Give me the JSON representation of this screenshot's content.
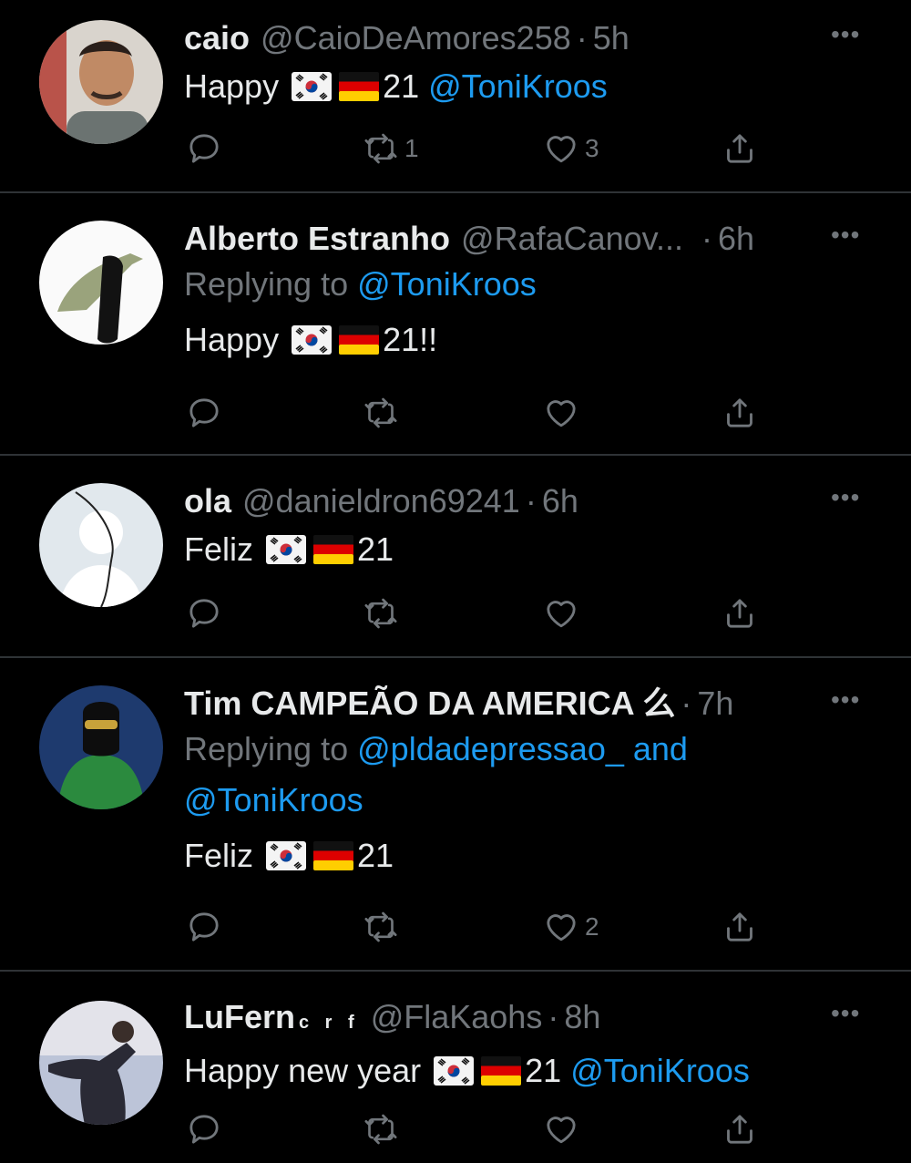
{
  "tweets": [
    {
      "name": "caio",
      "handle": "@CaioDeAmores258",
      "time": "5h",
      "text_prefix": "Happy",
      "text_suffix": "21",
      "mention": "@ToniKroos",
      "flags": [
        "south-korea-flag",
        "germany-flag"
      ],
      "retweets": "1",
      "likes": "3"
    },
    {
      "name": "Alberto Estranho",
      "handle": "@RafaCanov...",
      "time": "6h",
      "replying_label": "Replying to",
      "replying_to": "@ToniKroos",
      "text_prefix": "Happy",
      "text_suffix": "21!!",
      "flags": [
        "south-korea-flag",
        "germany-flag"
      ],
      "retweets": "",
      "likes": ""
    },
    {
      "name": "ola",
      "handle": "@danieldron69241",
      "time": "6h",
      "text_prefix": "Feliz",
      "text_suffix": "21",
      "flags": [
        "south-korea-flag",
        "germany-flag"
      ],
      "retweets": "",
      "likes": ""
    },
    {
      "name": "Tim CAMPEÃO DA AMERICA 么",
      "time": "7h",
      "replying_label": "Replying to",
      "replying_to_1": "@pldadepressao_",
      "replying_and": "and",
      "replying_to_2": "@ToniKroos",
      "text_prefix": "Feliz",
      "text_suffix": "21",
      "flags": [
        "south-korea-flag",
        "germany-flag"
      ],
      "retweets": "",
      "likes": "2"
    },
    {
      "name": "LuFern",
      "name_superscript": "c r f",
      "handle": "@FlaKaohs",
      "time": "8h",
      "text_prefix": "Happy new year",
      "text_suffix": "21",
      "mention": "@ToniKroos",
      "flags": [
        "south-korea-flag",
        "germany-flag"
      ],
      "retweets": "",
      "likes": ""
    }
  ],
  "separator": "·",
  "more_glyph": "•••",
  "colors": {
    "background": "#000000",
    "text": "#e7e9ea",
    "muted": "#71767b",
    "mention": "#1d9bf0",
    "divider": "#2f3336"
  }
}
